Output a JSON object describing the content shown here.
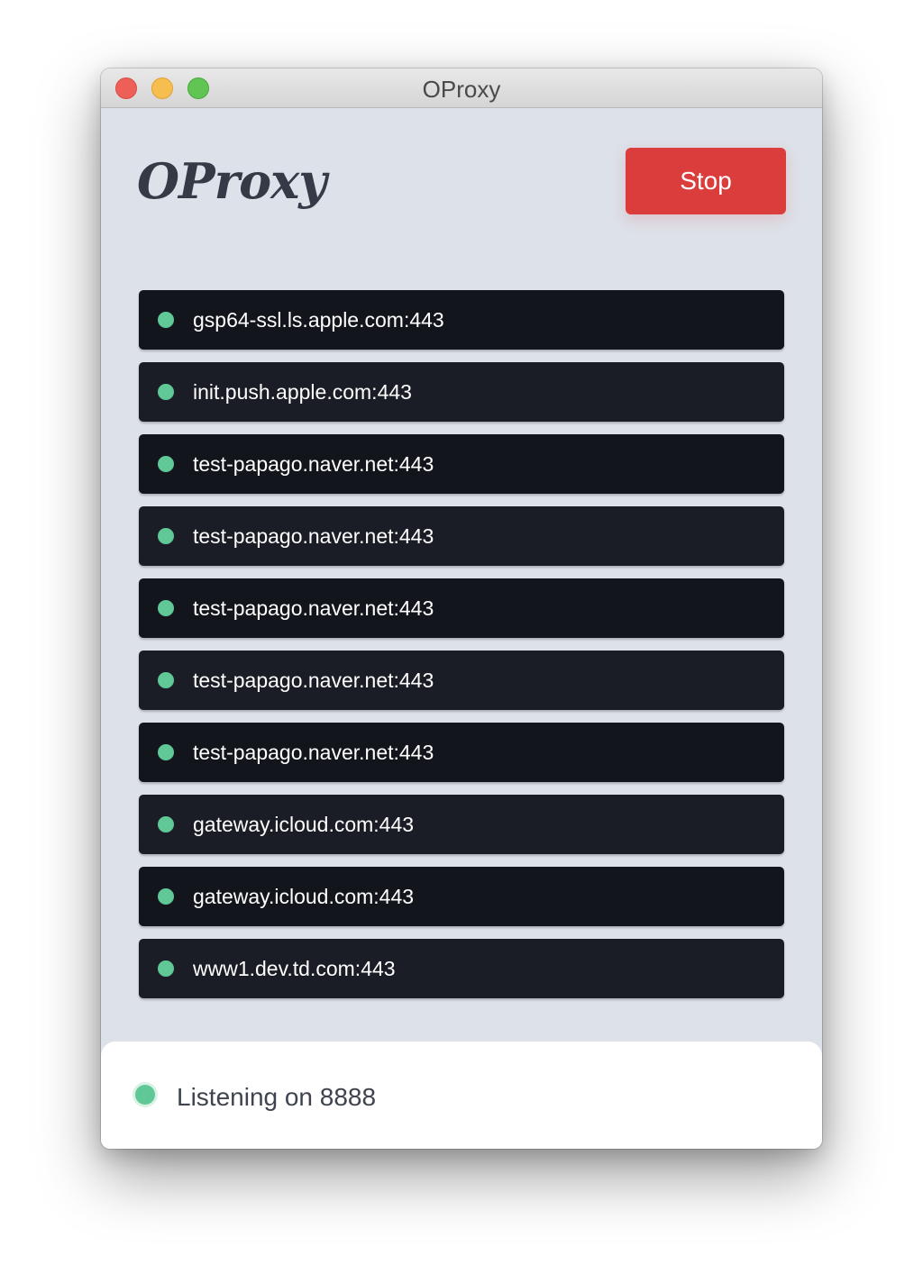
{
  "window": {
    "title": "OProxy"
  },
  "header": {
    "logo_text": "OProxy",
    "stop_label": "Stop"
  },
  "connections": [
    {
      "host": "gsp64-ssl.ls.apple.com:443",
      "status": "active"
    },
    {
      "host": "init.push.apple.com:443",
      "status": "active"
    },
    {
      "host": "test-papago.naver.net:443",
      "status": "active"
    },
    {
      "host": "test-papago.naver.net:443",
      "status": "active"
    },
    {
      "host": "test-papago.naver.net:443",
      "status": "active"
    },
    {
      "host": "test-papago.naver.net:443",
      "status": "active"
    },
    {
      "host": "test-papago.naver.net:443",
      "status": "active"
    },
    {
      "host": "gateway.icloud.com:443",
      "status": "active"
    },
    {
      "host": "gateway.icloud.com:443",
      "status": "active"
    },
    {
      "host": "www1.dev.td.com:443",
      "status": "active"
    }
  ],
  "footer": {
    "status_text": "Listening on 8888",
    "status": "listening"
  },
  "colors": {
    "accent_stop": "#db3c3c",
    "status_green": "#5fc896",
    "row_dark": "#13151d",
    "row_alt": "#1a1c26",
    "window_bg": "#dde1e9"
  }
}
